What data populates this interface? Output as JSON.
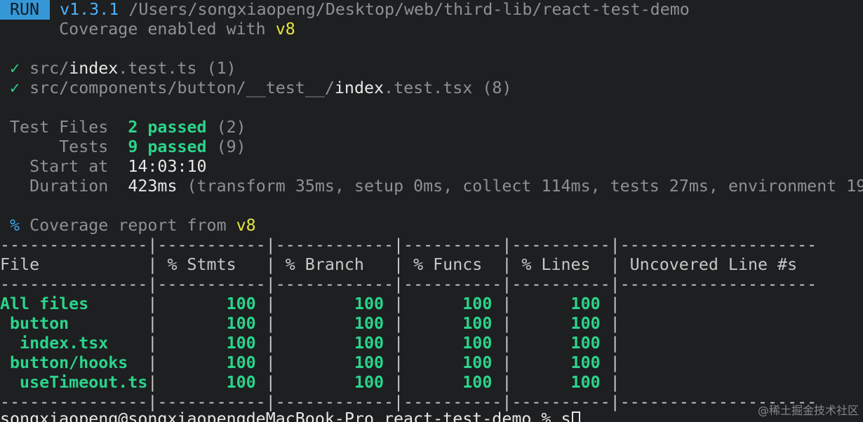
{
  "run": {
    "badge": "RUN",
    "version": "v1.3.1",
    "path": "/Users/songxiaopeng/Desktop/web/third-lib/react-test-demo",
    "coverage_prefix": "Coverage enabled with",
    "coverage_provider": "v8"
  },
  "test_files": [
    {
      "check": "✓",
      "dir": "src/",
      "name": "index",
      "ext": ".test.ts",
      "count": "(1)"
    },
    {
      "check": "✓",
      "dir": "src/components/button/__test__/",
      "name": "index",
      "ext": ".test.tsx",
      "count": "(8)"
    }
  ],
  "summary": {
    "test_files_label": "Test Files",
    "test_files_passed": "2 passed",
    "test_files_total": "(2)",
    "tests_label": "Tests",
    "tests_passed": "9 passed",
    "tests_total": "(9)",
    "start_label": "Start at",
    "start_value": "14:03:10",
    "duration_label": "Duration",
    "duration_value": "423ms",
    "duration_detail": "(transform 35ms, setup 0ms, collect 114ms, tests 27ms, environment 19"
  },
  "coverage_report": {
    "percent": "%",
    "text": "Coverage report from",
    "provider": "v8"
  },
  "table": {
    "separator": "---------------|-----------|------------|----------|----------|--------------------",
    "header_line": "File           | % Stmts   | % Branch   | % Funcs  | % Lines  | Uncovered Line #s",
    "headers": [
      "File",
      "% Stmts",
      "% Branch",
      "% Funcs",
      "% Lines",
      "Uncovered Line #s"
    ],
    "rows": [
      {
        "file": "All files",
        "stmts": "100",
        "branch": "100",
        "funcs": "100",
        "lines": "100",
        "uncovered": ""
      },
      {
        "file": " button",
        "stmts": "100",
        "branch": "100",
        "funcs": "100",
        "lines": "100",
        "uncovered": ""
      },
      {
        "file": "  index.tsx",
        "stmts": "100",
        "branch": "100",
        "funcs": "100",
        "lines": "100",
        "uncovered": ""
      },
      {
        "file": " button/hooks",
        "stmts": "100",
        "branch": "100",
        "funcs": "100",
        "lines": "100",
        "uncovered": ""
      },
      {
        "file": "  useTimeout.ts",
        "stmts": "100",
        "branch": "100",
        "funcs": "100",
        "lines": "100",
        "uncovered": ""
      }
    ]
  },
  "prompt": {
    "text": "songxiaopeng@songxiaopengdeMacBook-Pro react-test-demo % s"
  },
  "watermark": "@稀土掘金技术社区",
  "colors": {
    "background": "#1d1f21",
    "pass_green": "#2bd48a",
    "accent_yellow": "#e6e63c",
    "run_badge": "#3597d6",
    "dim_text": "#8e9194"
  }
}
